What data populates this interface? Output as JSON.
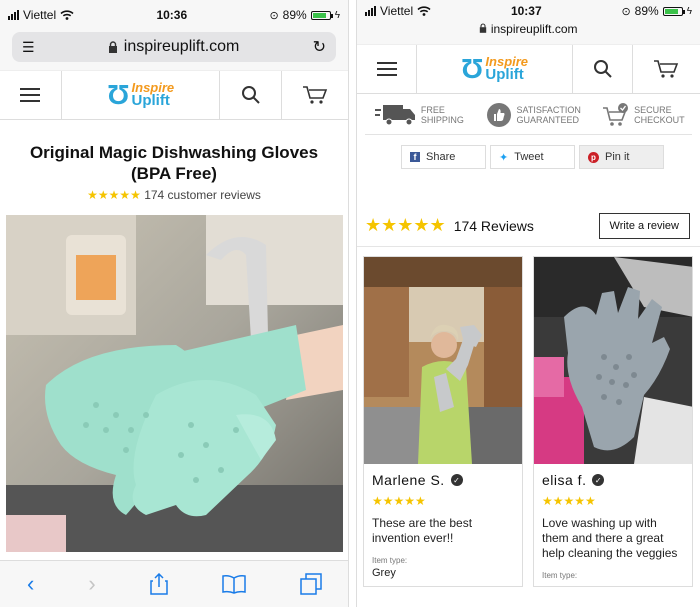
{
  "left": {
    "status": {
      "carrier": "Viettel",
      "time": "10:36",
      "battery": "89%"
    },
    "url": "inspireuplift.com",
    "logo": {
      "line1": "Inspire",
      "line2": "Uplift"
    },
    "product": {
      "title": "Original Magic Dishwashing Gloves (BPA Free)",
      "stars": "★★★★★",
      "reviews_text": "174 customer reviews"
    }
  },
  "right": {
    "status": {
      "carrier": "Viettel",
      "time": "10:37",
      "battery": "89%"
    },
    "url": "inspireuplift.com",
    "trust": [
      {
        "label": "FREE SHIPPING",
        "icon": "truck-icon"
      },
      {
        "label": "SATISFACTION GUARANTEED",
        "icon": "thumbs-up-icon"
      },
      {
        "label": "SECURE CHECKOUT",
        "icon": "cart-check-icon"
      }
    ],
    "share": [
      {
        "label": "Share",
        "icon": "facebook-icon"
      },
      {
        "label": "Tweet",
        "icon": "twitter-icon"
      },
      {
        "label": "Pin it",
        "icon": "pinterest-icon"
      }
    ],
    "reviews": {
      "stars": "★★★★★",
      "count_text": "174 Reviews",
      "write_label": "Write a review",
      "items": [
        {
          "name": "Marlene S.",
          "stars": "★★★★★",
          "text": "These are the best invention ever!!",
          "item_type_label": "Item type:",
          "item_type": "Grey"
        },
        {
          "name": "elisa f.",
          "stars": "★★★★★",
          "text": "Love washing up with them and there a great help cleaning the veggies",
          "item_type_label": "Item type:",
          "item_type": ""
        }
      ]
    }
  },
  "colors": {
    "star": "#f5c400",
    "logo_blue": "#2aa5d9",
    "logo_orange": "#f39a1e",
    "glove": "#9fe0cc",
    "link": "#1a7ce8"
  }
}
